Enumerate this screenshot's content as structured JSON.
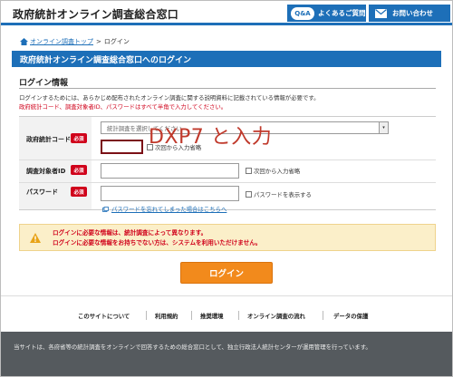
{
  "header": {
    "site_title": "政府統計オンライン調査総合窓口",
    "faq_badge": "Q&A",
    "faq_label": "よくあるご質問",
    "contact_label": "お問い合わせ"
  },
  "breadcrumb": {
    "home": "オンライン調査トップ",
    "separator": ">",
    "current": "ログイン"
  },
  "page_title": "政府統計オンライン調査総合窓口へのログイン",
  "section": {
    "title": "ログイン情報",
    "desc_line1": "ログインするためには、あらかじめ配布されたオンライン調査に関する説明資料に記載されている情報が必要です。",
    "desc_line2": "政府統計コード、調査対象者ID、パスワードはすべて半角で入力してください。"
  },
  "form": {
    "required_badge": "必須",
    "code_label": "政府統計コード",
    "select_value": "統計調査を選択してください",
    "code_remember": "次回から入力省略",
    "id_label": "調査対象者ID",
    "id_remember": "次回から入力省略",
    "password_label": "パスワード",
    "show_password": "パスワードを表示する",
    "forgot_link": "パスワードを忘れてしまった場合はこちらへ"
  },
  "annotation": "DXP7 と入力",
  "notice": {
    "line1": "ログインに必要な情報は、統計調査によって異なります。",
    "line2": "ログインに必要な情報をお持ちでない方は、システムを利用いただけません。"
  },
  "login_button": "ログイン",
  "footer": {
    "links": [
      "このサイトについて",
      "利用規約",
      "推奨環境",
      "オンライン調査の流れ",
      "データの保護"
    ],
    "notice": "当サイトは、各府省等の統計調査をオンラインで回答するための総合窓口として、独立行政法人統計センターが運用管理を行っています。"
  },
  "colors": {
    "brand_blue": "#1d6fb8",
    "required_red": "#d0021b",
    "login_orange": "#f28a1c"
  }
}
